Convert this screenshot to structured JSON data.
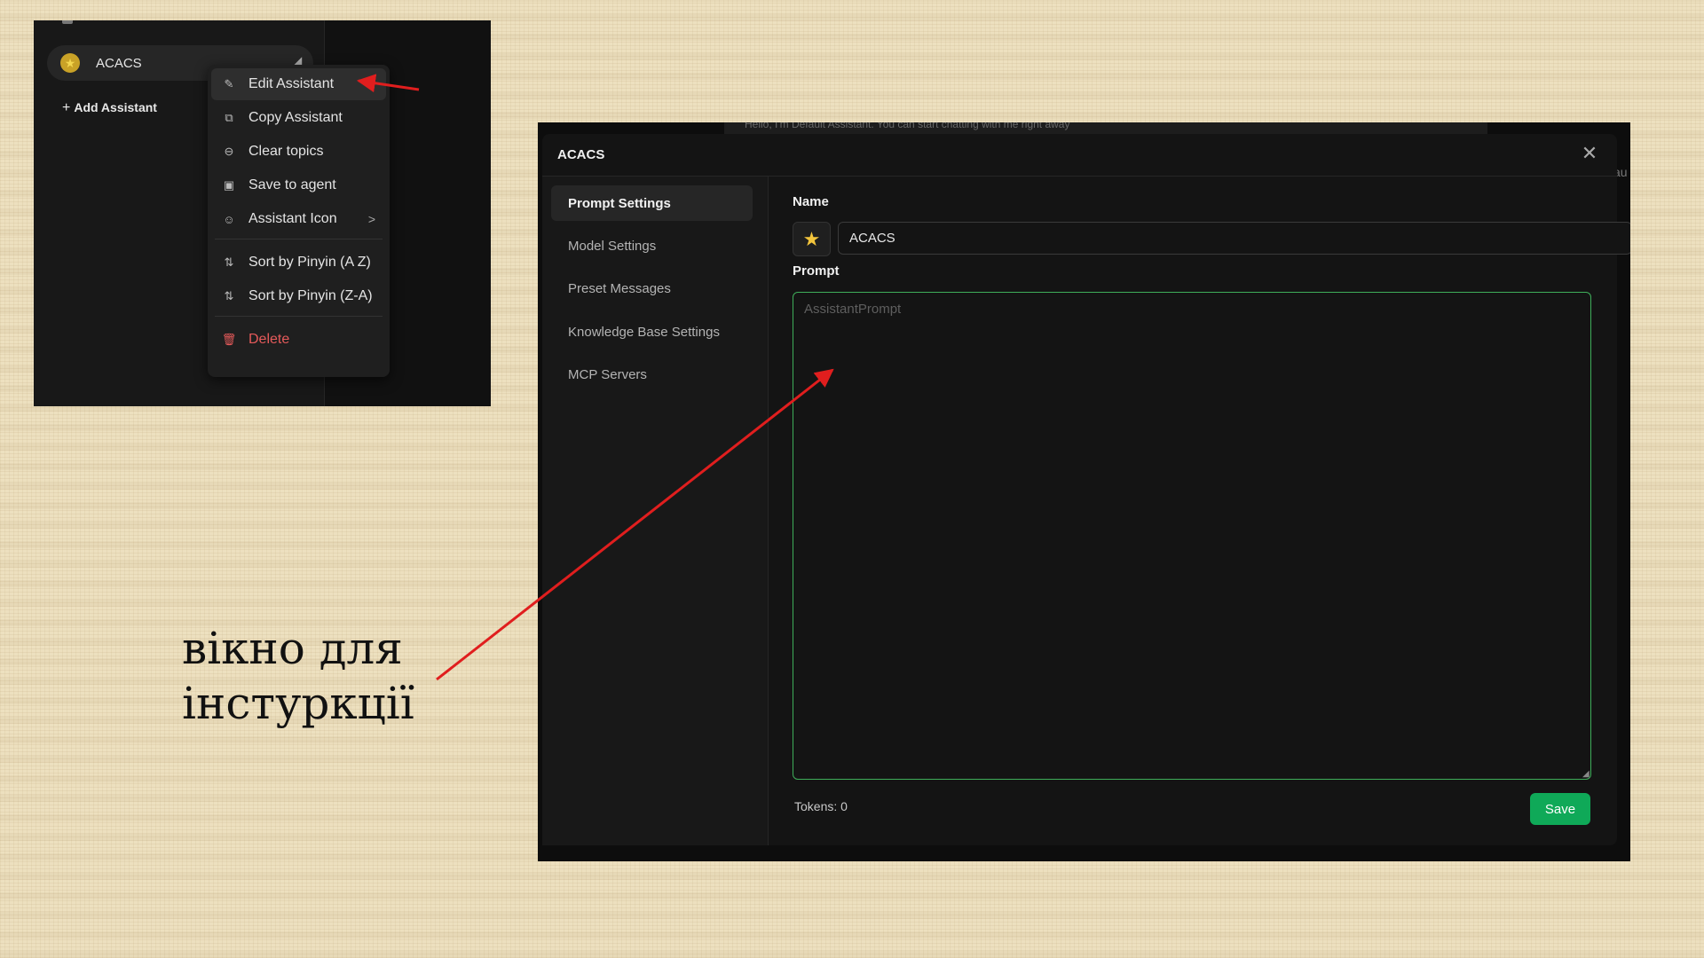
{
  "left_screenshot": {
    "assistant_chip": {
      "name": "ACACS",
      "avatar_icon": "star-icon"
    },
    "add_assistant_label": "Add Assistant",
    "context_menu": {
      "items": [
        {
          "label": "Edit Assistant",
          "icon": "edit-icon"
        },
        {
          "label": "Copy Assistant",
          "icon": "copy-icon"
        },
        {
          "label": "Clear topics",
          "icon": "minus-circle-icon"
        },
        {
          "label": "Save to agent",
          "icon": "save-icon"
        },
        {
          "label": "Assistant Icon",
          "icon": "smile-icon",
          "chevron": ">"
        },
        {
          "label": "Sort by Pinyin (A Z)",
          "icon": "sort-asc-icon"
        },
        {
          "label": "Sort by Pinyin (Z-A)",
          "icon": "sort-desc-icon"
        },
        {
          "label": "Delete",
          "icon": "trash-icon"
        }
      ]
    }
  },
  "right_screenshot": {
    "background_hint": "Hello, I'm Default Assistant. You can start chatting with me right away",
    "background_edge_text": "au",
    "modal": {
      "title": "ACACS",
      "close_glyph": "✕",
      "nav": [
        {
          "label": "Prompt Settings",
          "active": true
        },
        {
          "label": "Model Settings"
        },
        {
          "label": "Preset Messages"
        },
        {
          "label": "Knowledge Base Settings"
        },
        {
          "label": "MCP Servers"
        }
      ],
      "name_label": "Name",
      "name_value": "ACACS",
      "emoji_icon": "star-icon",
      "prompt_label": "Prompt",
      "prompt_placeholder": "AssistantPrompt",
      "tokens_text": "Tokens: 0",
      "save_label": "Save"
    }
  },
  "annotation": {
    "line1": "вікно для",
    "line2": "інстуркції",
    "arrow_color": "#e01e1e"
  },
  "colors": {
    "accent_green": "#0fa958",
    "prompt_border": "#3fae5a",
    "danger": "#e55a5a",
    "star": "#f3c53c"
  }
}
